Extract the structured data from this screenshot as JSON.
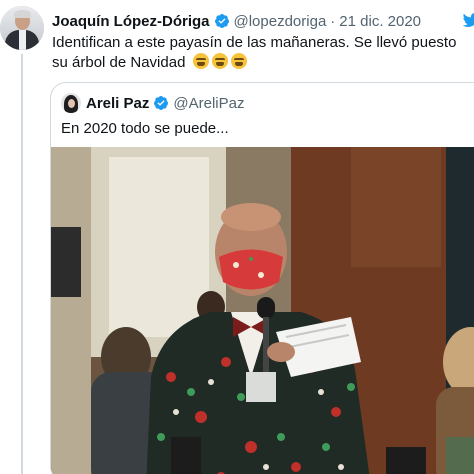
{
  "tweet": {
    "author_name": "Joaquín López-Dóriga",
    "handle": "@lopezdoriga",
    "separator": "·",
    "date": "21 dic. 2020",
    "text": "Identifican a este payasín de las mañaneras. Se llevó puesto su árbol de Navidad",
    "emojis": [
      "tired-face-emoji",
      "tired-face-emoji",
      "tired-face-emoji"
    ]
  },
  "quoted_tweet": {
    "author_name": "Areli Paz",
    "handle": "@AreliPaz",
    "text": "En 2020 todo se puede...",
    "media": {
      "description_icon": "photo"
    }
  },
  "icons": {
    "verified": "verified-badge-icon",
    "brand": "twitter-bird-icon"
  },
  "colors": {
    "verified_blue": "#1d9bf0",
    "secondary_text": "#536471",
    "border": "#cfd9de",
    "primary_text": "#0f1419"
  }
}
